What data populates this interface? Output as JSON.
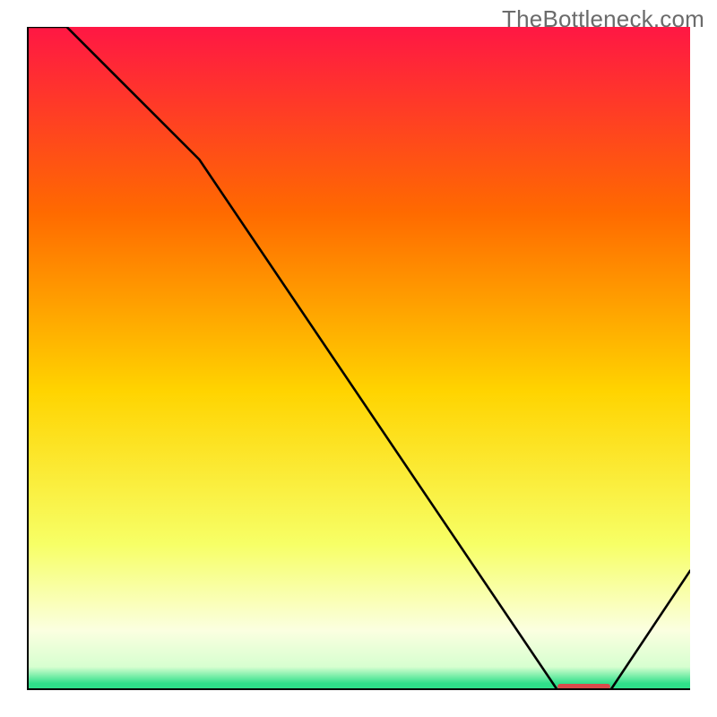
{
  "watermark": "TheBottleneck.com",
  "colors": {
    "top": "#ff1744",
    "mid_upper": "#ff6a00",
    "mid": "#ffd400",
    "mid_lower": "#f7ff66",
    "cream": "#fbffe0",
    "green": "#2fe08a",
    "line": "#000000",
    "marker": "#d94b4b",
    "axis": "#000000"
  },
  "chart_data": {
    "type": "line",
    "title": "",
    "xlabel": "",
    "ylabel": "",
    "xlim": [
      0,
      100
    ],
    "ylim": [
      0,
      100
    ],
    "x": [
      0,
      6,
      26,
      80,
      88,
      100
    ],
    "values": [
      100,
      100,
      80,
      0,
      0,
      18
    ],
    "min_region_x": [
      80,
      88
    ],
    "gradient_stops": [
      {
        "pct": 0,
        "color": "#ff1744"
      },
      {
        "pct": 28,
        "color": "#ff6a00"
      },
      {
        "pct": 55,
        "color": "#ffd400"
      },
      {
        "pct": 78,
        "color": "#f7ff66"
      },
      {
        "pct": 91,
        "color": "#fbffe0"
      },
      {
        "pct": 96.5,
        "color": "#d7ffd0"
      },
      {
        "pct": 99,
        "color": "#2fe08a"
      },
      {
        "pct": 100,
        "color": "#2fe08a"
      }
    ],
    "notes": "Vertical gradient background from red at top through orange, yellow, pale yellow to a thin green band at the bottom. Black curve descends from top-left, reaches zero around x≈80–88, then rises toward the right edge. A short horizontal red marker sits on the x-axis at the curve's minimum."
  }
}
